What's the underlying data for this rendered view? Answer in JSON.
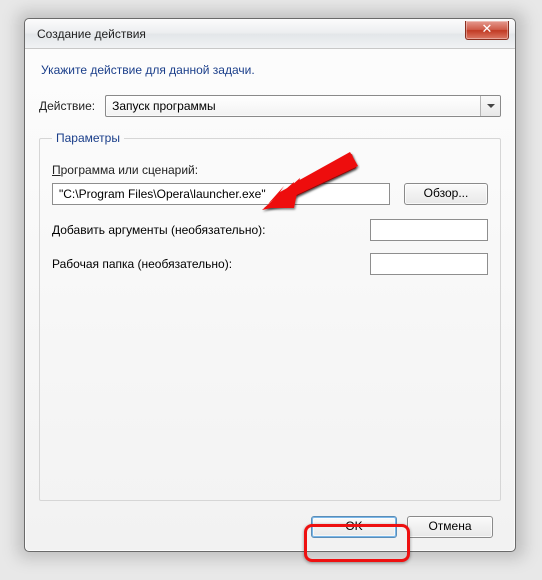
{
  "window": {
    "title": "Создание действия"
  },
  "instruction": "Укажите действие для данной задачи.",
  "action": {
    "label": "Действие:",
    "selected": "Запуск программы"
  },
  "params": {
    "legend": "Параметры",
    "program_label_pre": "П",
    "program_label_rest": "рограмма или сценарий:",
    "program_value": "\"C:\\Program Files\\Opera\\launcher.exe\"",
    "browse_label": "Обзор...",
    "args_label": "Добавить аргументы (необязательно):",
    "args_value": "",
    "workdir_label": "Рабочая папка (необязательно):",
    "workdir_value": ""
  },
  "buttons": {
    "ok": "OK",
    "cancel": "Отмена"
  }
}
